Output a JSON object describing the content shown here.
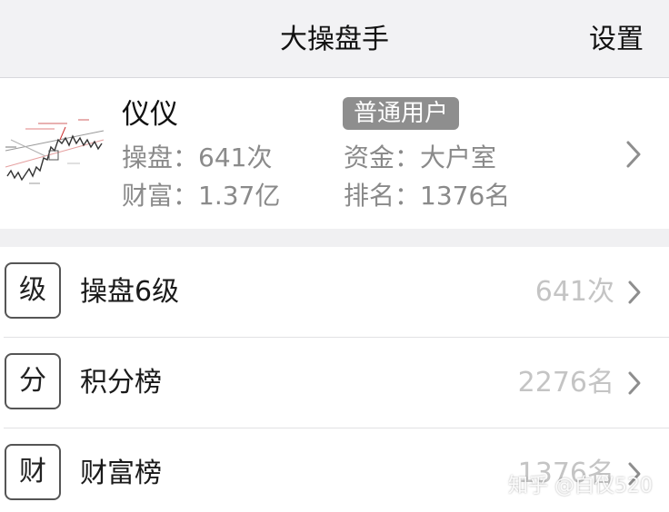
{
  "header": {
    "title": "大操盘手",
    "settings_label": "设置"
  },
  "profile": {
    "name": "仪仪",
    "badge": "普通用户",
    "trades": "操盘：641次",
    "wealth": "财富：1.37亿",
    "funds": "资金：大户室",
    "rank": "排名：1376名"
  },
  "list": {
    "items": [
      {
        "icon_text": "级",
        "label": "操盘6级",
        "value": "641次"
      },
      {
        "icon_text": "分",
        "label": "积分榜",
        "value": "2276名"
      },
      {
        "icon_text": "财",
        "label": "财富榜",
        "value": "1376名"
      }
    ]
  },
  "watermark": "知乎 @白仪520",
  "colors": {
    "background": "#f0f0f2",
    "badge": "#8e8e8e",
    "secondary_text": "#8a8a8a",
    "value_text": "#c4c4c4"
  }
}
